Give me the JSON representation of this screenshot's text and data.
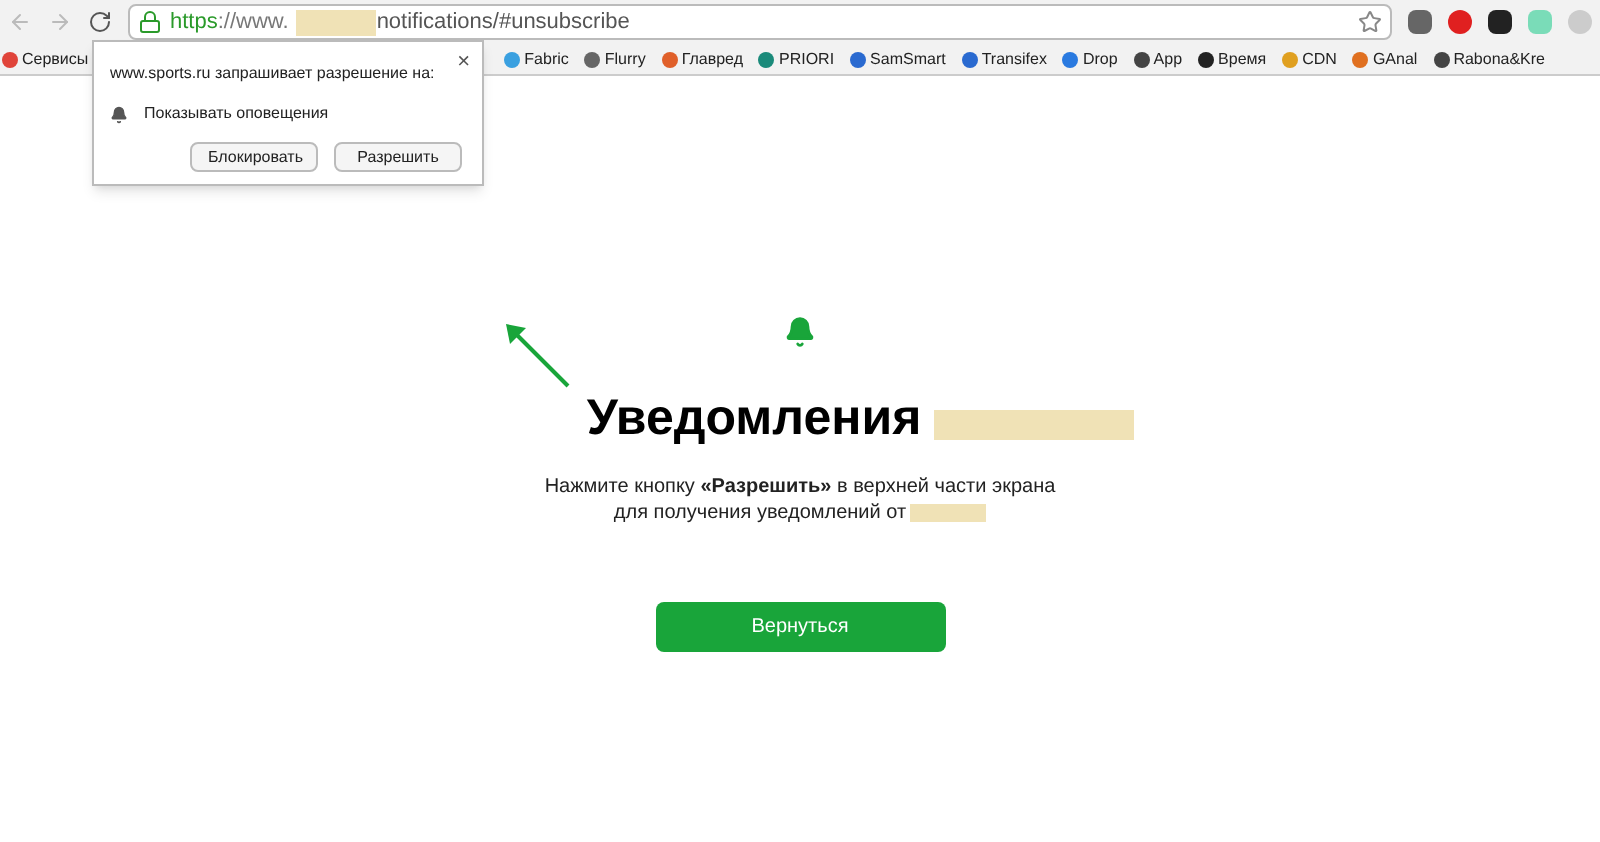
{
  "address_bar": {
    "scheme": "https",
    "prefix": "://www.",
    "path": "notifications/#unsubscribe"
  },
  "bookmarks": [
    {
      "label": "Сервисы",
      "color": "#e0443a"
    },
    {
      "label": "Fabric",
      "color": "#3aa0e0"
    },
    {
      "label": "Flurry",
      "color": "#666666"
    },
    {
      "label": "Главред",
      "color": "#e0602a"
    },
    {
      "label": "PRIORI",
      "color": "#1a8a7a"
    },
    {
      "label": "SamSmart",
      "color": "#2a6ad0"
    },
    {
      "label": "Transifex",
      "color": "#2a6ad0"
    },
    {
      "label": "Drop",
      "color": "#2a7ae0"
    },
    {
      "label": "App",
      "color": "#444444"
    },
    {
      "label": "Время",
      "color": "#222222"
    },
    {
      "label": "CDN",
      "color": "#e0a020"
    },
    {
      "label": "GAnal",
      "color": "#e07020"
    },
    {
      "label": "Rabona&Kre",
      "color": "#444444"
    }
  ],
  "permission_popup": {
    "close": "×",
    "message": "www.sports.ru запрашивает разрешение на:",
    "permission": "Показывать оповещения",
    "buttons": [
      "Блокировать",
      "Разрешить"
    ]
  },
  "page": {
    "title": "Уведомления",
    "line_1_before": "Нажмите кнопку ",
    "line_1_bold": "«Разрешить»",
    "line_1_after": " в верхней части экрана",
    "line_2": "для получения уведомлений от",
    "button": "Вернуться"
  }
}
